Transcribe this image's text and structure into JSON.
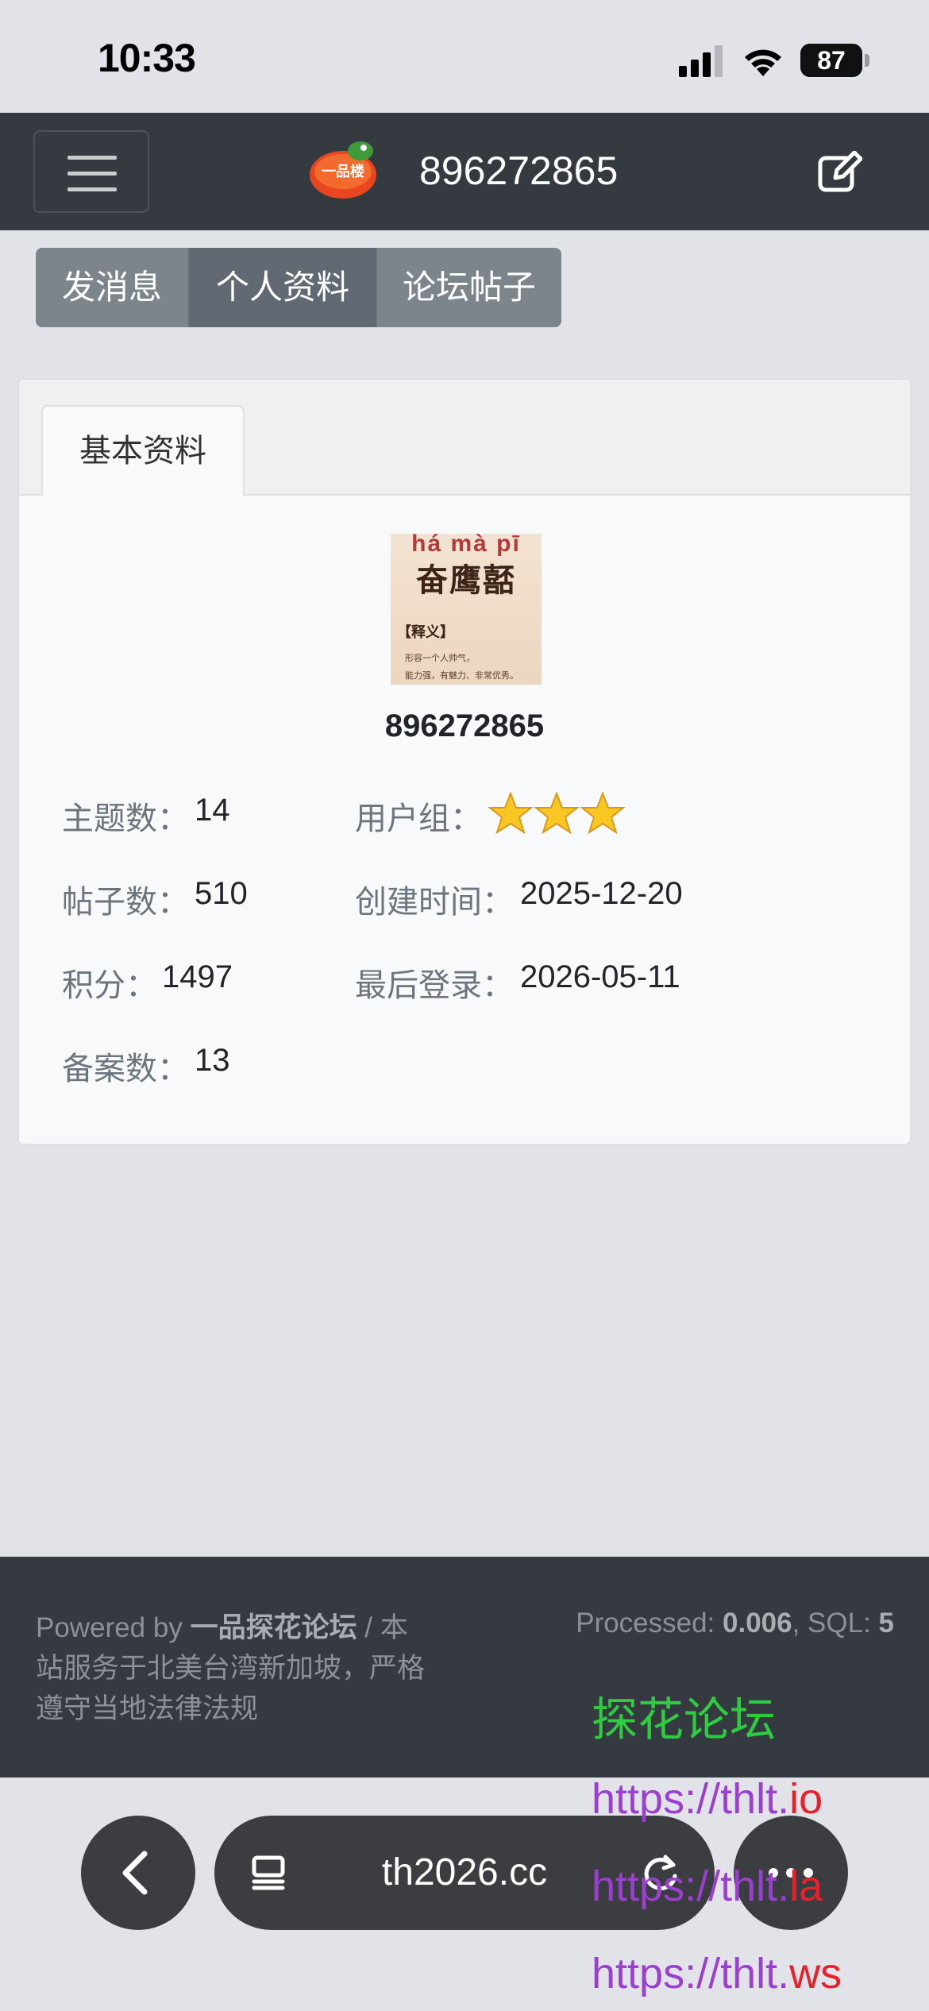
{
  "status_bar": {
    "time": "10:33",
    "battery": "87"
  },
  "navbar": {
    "title": "896272865",
    "logo_text": "一品楼"
  },
  "actions": {
    "send_message": "发消息",
    "profile": "个人资料",
    "posts": "论坛帖子"
  },
  "card": {
    "tab": "基本资料",
    "avatar": {
      "pinyin": "há mà pī",
      "word": "奋鹰嚭",
      "sy": "【释义】",
      "line1": "形容一个人帅气，",
      "line2": "能力强，有魅力、非常优秀。"
    },
    "username": "896272865",
    "stats": {
      "topics_label": "主题数：",
      "topics": "14",
      "posts_label": "帖子数：",
      "posts": "510",
      "points_label": "积分：",
      "points": "1497",
      "records_label": "备案数：",
      "records": "13",
      "group_label": "用户组：",
      "group_stars": 3,
      "created_label": "创建时间：",
      "created": "2025-12-20",
      "last_login_label": "最后登录：",
      "last_login": "2026-05-11"
    }
  },
  "footer": {
    "powered_prefix": "Powered by ",
    "forum_name": "一品探花论坛",
    "powered_suffix": " / 本站服务于北美台湾新加坡，严格遵守当地法律法规",
    "processed_label": "Processed: ",
    "processed": "0.006",
    "sql_label": ", SQL: ",
    "sql": "5"
  },
  "overlay": {
    "title": "探花论坛",
    "links": [
      {
        "prefix": "https://thlt.",
        "suffix": "io"
      },
      {
        "prefix": "https://thlt.",
        "suffix": "la"
      },
      {
        "prefix": "https://thlt.",
        "suffix": "ws"
      }
    ]
  },
  "browser": {
    "url": "th2026.cc"
  },
  "colors": {
    "navbar": "#343a40",
    "button": "#7d858c",
    "overlay_green": "#2ecc40",
    "overlay_purple": "#9b3fd1",
    "overlay_red": "#e8202a"
  }
}
